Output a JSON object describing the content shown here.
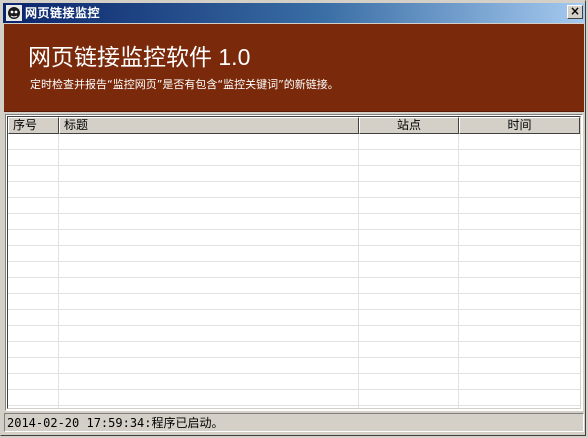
{
  "window": {
    "title": "网页链接监控",
    "close_label": "×"
  },
  "banner": {
    "title": "网页链接监控软件 1.0",
    "description": "定时检查并报告“监控网页”是否有包含“监控关键词”的新链接。"
  },
  "table": {
    "columns": [
      "序号",
      "标题",
      "站点",
      "时间"
    ],
    "rows": []
  },
  "status": {
    "text": "2014-02-20 17:59:34:程序已启动。"
  },
  "colors": {
    "banner_bg": "#7a2a0a",
    "title_gradient_start": "#0a246a",
    "title_gradient_end": "#a6caf0"
  }
}
